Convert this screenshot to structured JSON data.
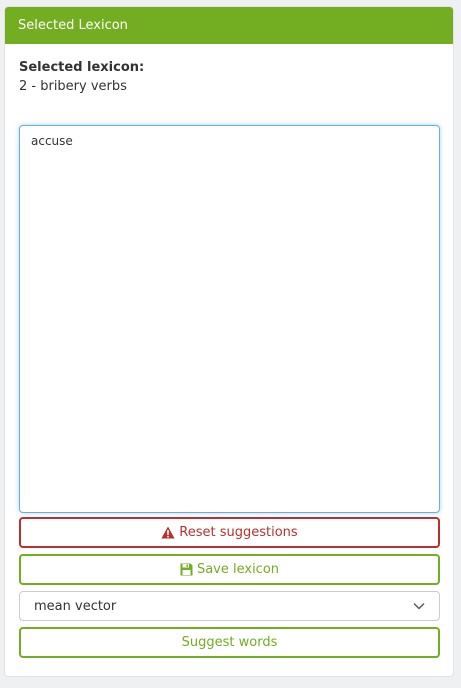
{
  "panel": {
    "heading": "Selected Lexicon",
    "lexicon_label": "Selected lexicon:",
    "lexicon_value": "2 - bribery verbs"
  },
  "editor": {
    "content": "accuse"
  },
  "buttons": {
    "reset_label": "Reset suggestions",
    "reset_icon": "warning-icon",
    "save_label": "Save lexicon",
    "save_icon": "floppy-disk-icon",
    "suggest_label": "Suggest words"
  },
  "method_select": {
    "selected": "mean vector",
    "icon": "chevron-down-icon"
  },
  "colors": {
    "brand_green": "#73ad21",
    "danger_red": "#b9312c",
    "focus_blue": "#66afe9"
  }
}
